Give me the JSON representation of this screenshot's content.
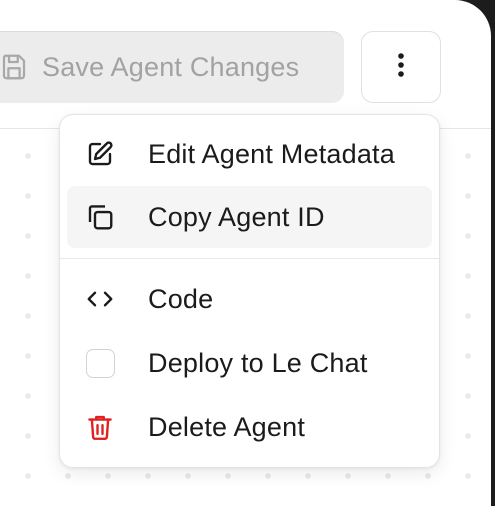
{
  "toolbar": {
    "save_label": "Save Agent Changes",
    "save_icon": "floppy-disk-icon",
    "more_icon": "vertical-ellipsis-icon"
  },
  "menu": {
    "items": [
      {
        "label": "Edit Agent Metadata",
        "icon": "edit-icon"
      },
      {
        "label": "Copy Agent ID",
        "icon": "copy-icon",
        "highlighted": true
      },
      {
        "label": "Code",
        "icon": "code-brackets-icon"
      },
      {
        "label": "Deploy to Le Chat",
        "icon": "checkbox",
        "checked": false
      },
      {
        "label": "Delete Agent",
        "icon": "trash-icon",
        "color": "#e0201f"
      }
    ]
  },
  "colors": {
    "danger": "#e0201f",
    "text": "#1b1b1b",
    "disabled_text": "#a2a2a2"
  }
}
